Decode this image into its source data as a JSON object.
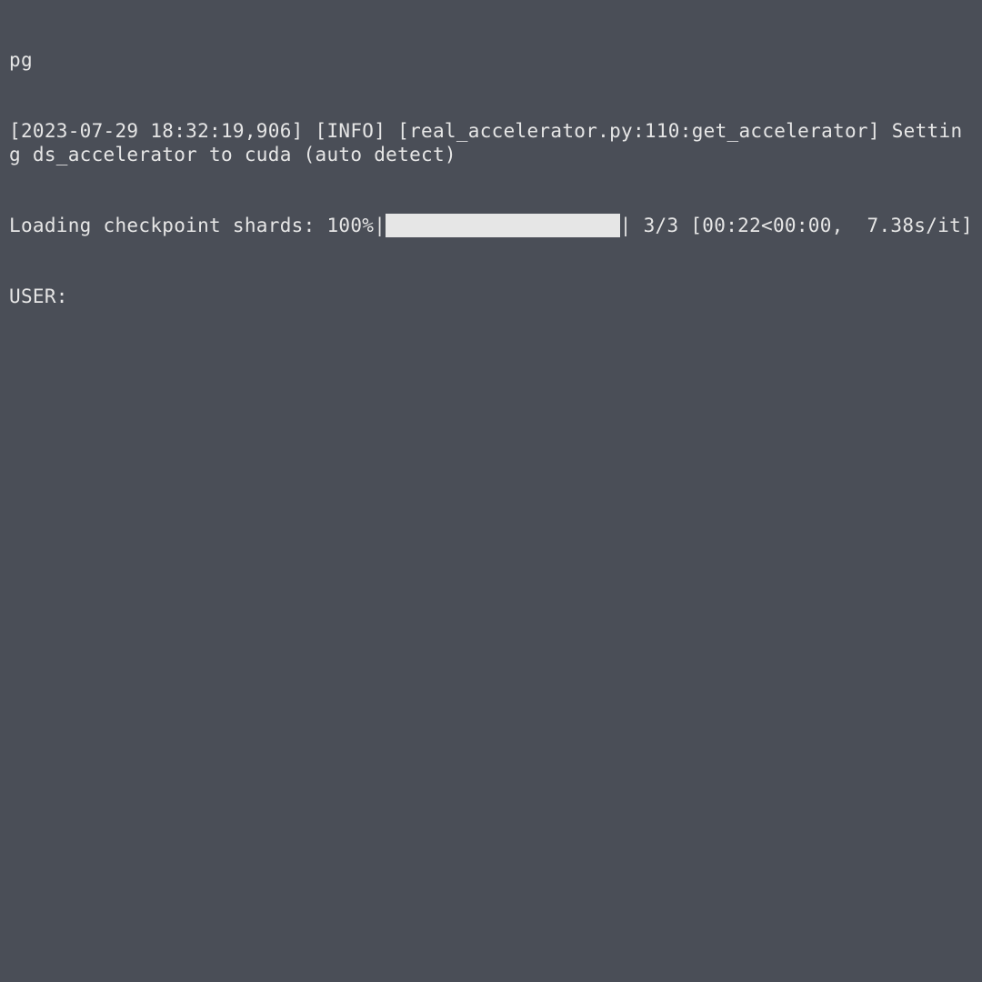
{
  "terminal": {
    "line_pg": "pg",
    "log_line": "[2023-07-29 18:32:19,906] [INFO] [real_accelerator.py:110:get_accelerator] Setting ds_accelerator to cuda (auto detect)",
    "progress": {
      "prefix": "Loading checkpoint shards: 100%|",
      "suffix": "| 3/3 [00:22<00:00,  7.38s/it]"
    },
    "user_prompt": "USER: "
  }
}
